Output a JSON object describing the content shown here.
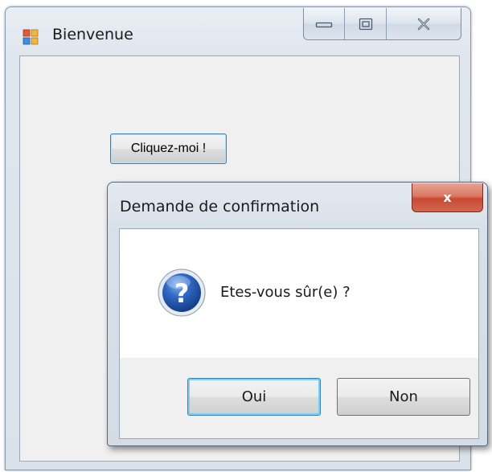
{
  "main_window": {
    "title": "Bienvenue",
    "icon": "windows-form-icon",
    "caption_buttons": {
      "minimize_icon": "minimize-icon",
      "maximize_icon": "maximize-icon",
      "close_icon": "close-icon"
    },
    "click_button_label": "Cliquez-moi !"
  },
  "dialog": {
    "title": "Demande de confirmation",
    "close_glyph": "x",
    "icon": "question-icon",
    "message": "Etes-vous sûr(e) ?",
    "buttons": {
      "yes_label": "Oui",
      "no_label": "Non"
    }
  },
  "colors": {
    "button_focus_border": "#3c7fb1",
    "close_button_red": "#c94a32",
    "question_icon_blue": "#1f4fa0"
  }
}
